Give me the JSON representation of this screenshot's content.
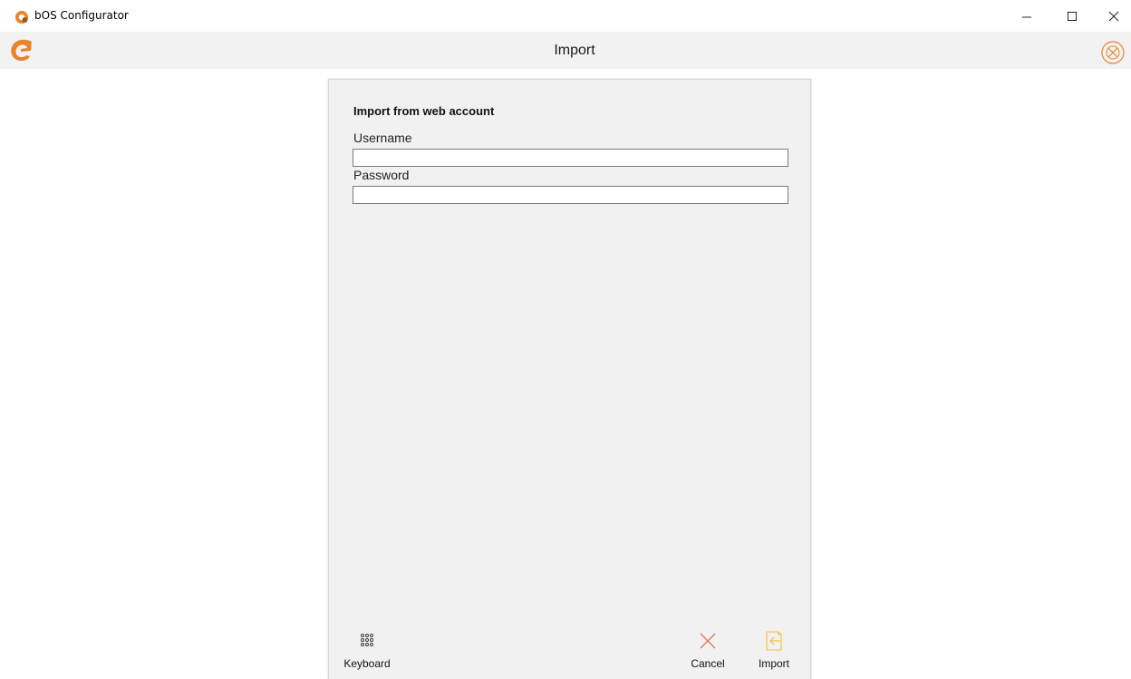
{
  "window": {
    "title": "bOS Configurator",
    "accent": "#e8842c"
  },
  "appbar": {
    "title": "Import",
    "close_icon": "circle-x-icon"
  },
  "dialog": {
    "heading": "Import from web account",
    "username": {
      "label": "Username",
      "value": "",
      "placeholder": ""
    },
    "password": {
      "label": "Password",
      "value": "",
      "placeholder": ""
    }
  },
  "buttons": {
    "keyboard": {
      "label": "Keyboard",
      "icon": "keypad-icon"
    },
    "cancel": {
      "label": "Cancel",
      "icon": "x-icon",
      "color": "#e6735a"
    },
    "import": {
      "label": "Import",
      "icon": "import-icon",
      "color": "#f1c232"
    }
  }
}
